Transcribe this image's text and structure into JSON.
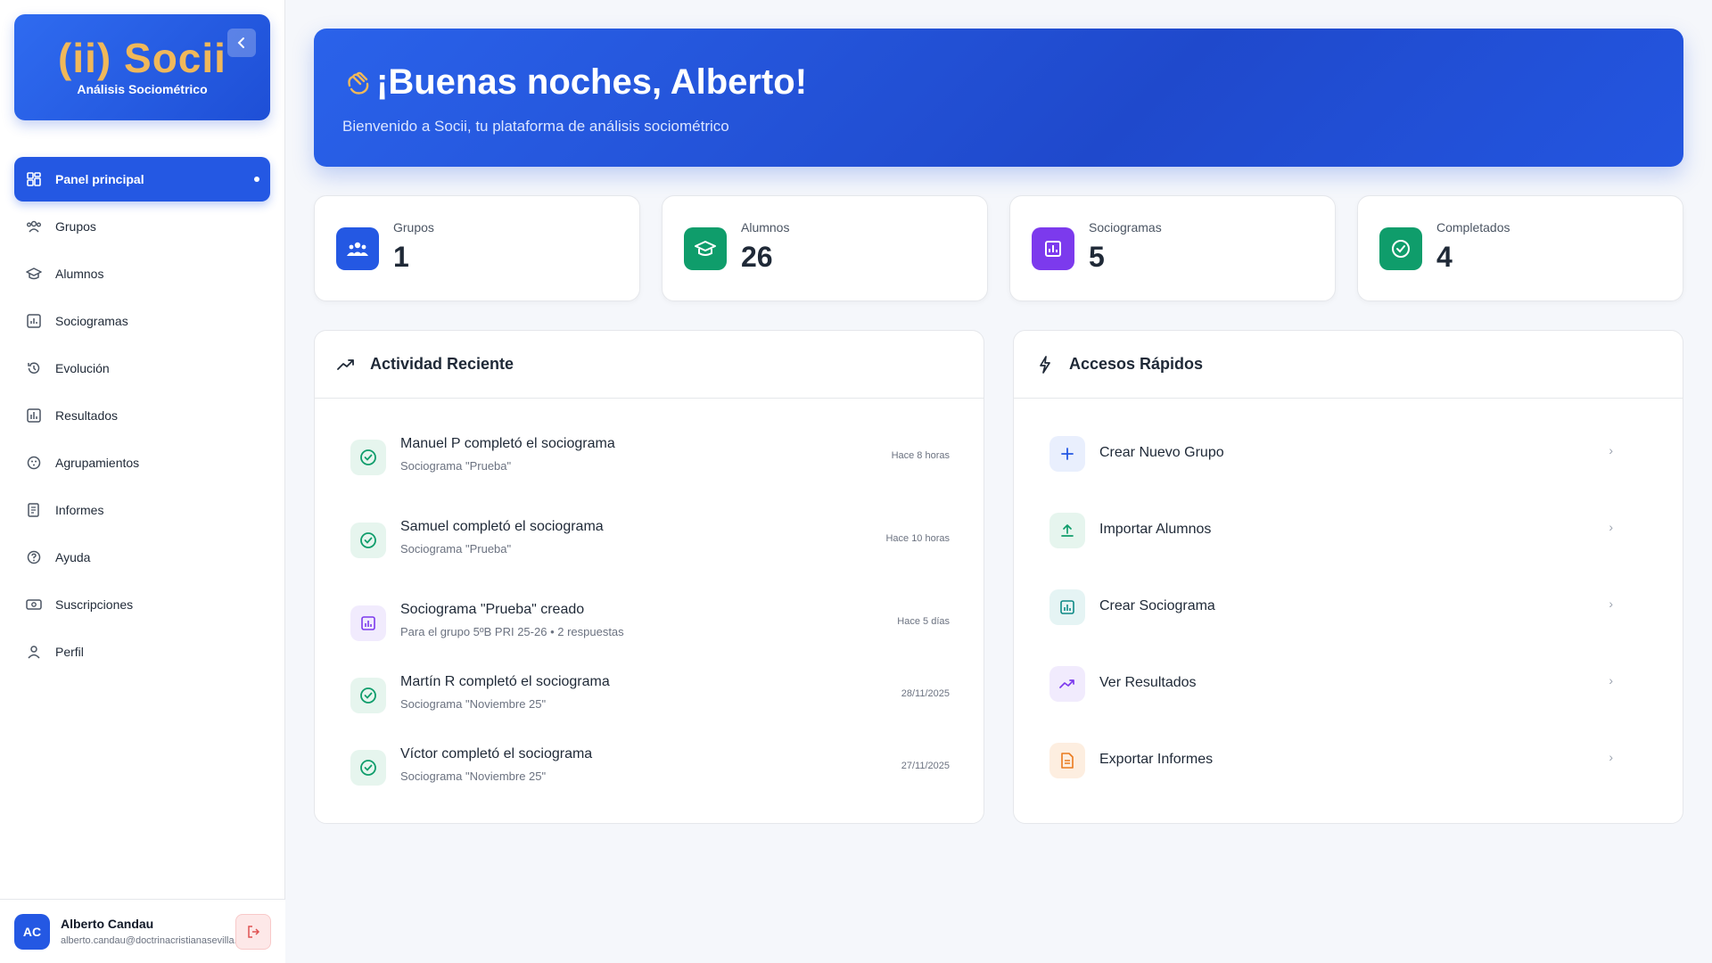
{
  "brand": {
    "logo": "(ii) Socii",
    "subtitle": "Análisis Sociométrico"
  },
  "sidebar": {
    "items": [
      {
        "label": "Panel principal",
        "icon": "dashboard-icon",
        "active": true
      },
      {
        "label": "Grupos",
        "icon": "users-icon"
      },
      {
        "label": "Alumnos",
        "icon": "graduation-cap-icon"
      },
      {
        "label": "Sociogramas",
        "icon": "chart-icon"
      },
      {
        "label": "Evolución",
        "icon": "history-icon"
      },
      {
        "label": "Resultados",
        "icon": "bar-chart-icon"
      },
      {
        "label": "Agrupamientos",
        "icon": "groups-icon"
      },
      {
        "label": "Informes",
        "icon": "report-icon"
      },
      {
        "label": "Ayuda",
        "icon": "help-icon"
      },
      {
        "label": "Suscripciones",
        "icon": "subscription-icon"
      },
      {
        "label": "Perfil",
        "icon": "user-icon"
      }
    ]
  },
  "user": {
    "initials": "AC",
    "name": "Alberto Candau",
    "email": "alberto.candau@doctrinacristianasevilla.es"
  },
  "hero": {
    "title": "¡Buenas noches, Alberto!",
    "subtitle": "Bienvenido a Socii, tu plataforma de análisis sociométrico"
  },
  "stats": [
    {
      "label": "Grupos",
      "value": "1",
      "color": "#2458e3",
      "icon": "users-icon"
    },
    {
      "label": "Alumnos",
      "value": "26",
      "color": "#0f9d6b",
      "icon": "graduation-cap-icon"
    },
    {
      "label": "Sociogramas",
      "value": "5",
      "color": "#7c3aed",
      "icon": "chart-icon"
    },
    {
      "label": "Completados",
      "value": "4",
      "color": "#0f9d6b",
      "icon": "check-circle-icon"
    }
  ],
  "activity": {
    "title": "Actividad Reciente",
    "items": [
      {
        "title": "Manuel P completó el sociograma",
        "subtitle": "Sociograma \"Prueba\"",
        "time": "Hace 8 horas",
        "icon": "check-circle-icon"
      },
      {
        "title": "Samuel completó el sociograma",
        "subtitle": "Sociograma \"Prueba\"",
        "time": "Hace 10 horas",
        "icon": "check-circle-icon"
      },
      {
        "title": "Sociograma \"Prueba\" creado",
        "subtitle": "Para el grupo 5ºB PRI 25-26 • 2 respuestas",
        "time": "Hace 5 días",
        "icon": "chart-icon"
      },
      {
        "title": "Martín R completó el sociograma",
        "subtitle": "Sociograma \"Noviembre 25\"",
        "time": "28/11/2025",
        "icon": "check-circle-icon"
      },
      {
        "title": "Víctor completó el sociograma",
        "subtitle": "Sociograma \"Noviembre 25\"",
        "time": "27/11/2025",
        "icon": "check-circle-icon"
      }
    ]
  },
  "quick": {
    "title": "Accesos Rápidos",
    "items": [
      {
        "label": "Crear Nuevo Grupo",
        "icon": "plus-icon"
      },
      {
        "label": "Importar Alumnos",
        "icon": "upload-icon"
      },
      {
        "label": "Crear Sociograma",
        "icon": "chart-icon"
      },
      {
        "label": "Ver Resultados",
        "icon": "trending-up-icon"
      },
      {
        "label": "Exportar Informes",
        "icon": "file-icon"
      }
    ]
  },
  "colors": {
    "primary": "#2458e3",
    "green": "#0f9d6b",
    "purple": "#7c3aed",
    "orange": "#ea7a1e",
    "accent_logo": "#f0b85a"
  }
}
